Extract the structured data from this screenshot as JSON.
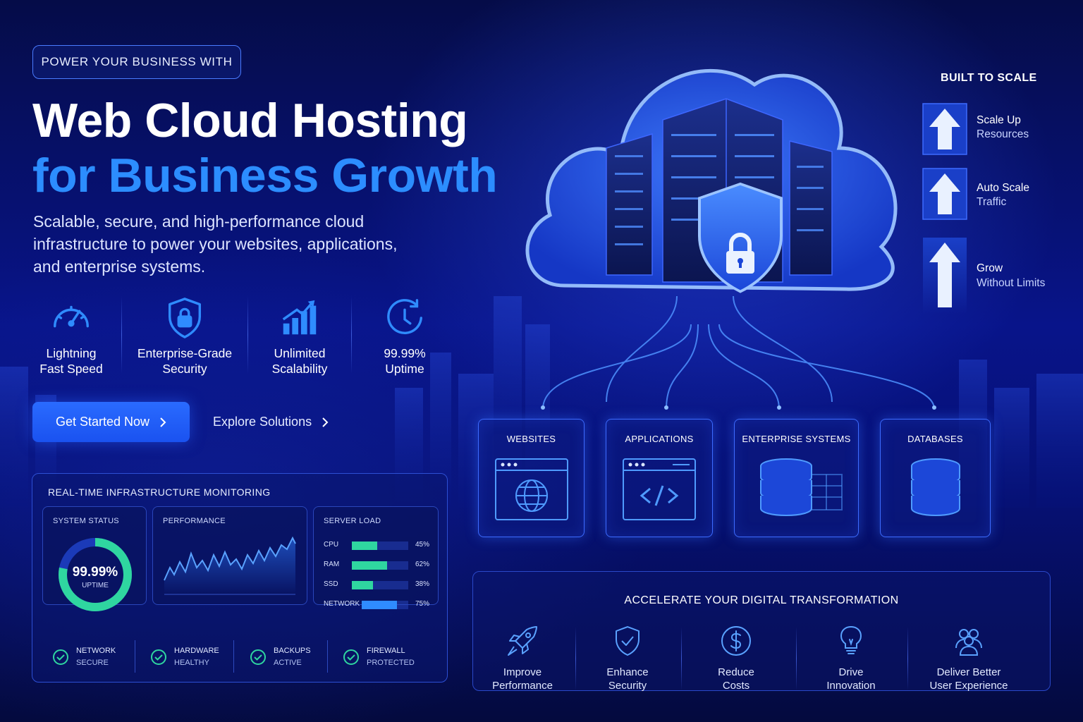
{
  "hero": {
    "tagline": "POWER YOUR BUSINESS WITH",
    "title_line1": "Web Cloud Hosting",
    "title_line2": "for Business Growth",
    "description": "Scalable, secure, and high-performance cloud infrastructure to power your websites, applications, and enterprise systems."
  },
  "features": [
    {
      "icon": "speedometer-icon",
      "line1": "Lightning",
      "line2": "Fast Speed"
    },
    {
      "icon": "shield-lock-icon",
      "line1": "Enterprise-Grade",
      "line2": "Security"
    },
    {
      "icon": "growth-chart-icon",
      "line1": "Unlimited",
      "line2": "Scalability"
    },
    {
      "icon": "clock-icon",
      "line1": "99.99%",
      "line2": "Uptime"
    }
  ],
  "actions": {
    "primary_label": "Get Started Now",
    "secondary_label": "Explore Solutions"
  },
  "monitoring": {
    "title": "REAL-TIME INFRASTRUCTURE MONITORING",
    "system_status": {
      "title": "SYSTEM STATUS",
      "value": "99.99%",
      "label": "UPTIME",
      "fill_fraction": 0.78
    },
    "performance": {
      "title": "PERFORMANCE"
    },
    "server_load": {
      "title": "SERVER LOAD",
      "rows": [
        {
          "name": "CPU",
          "percent": 45,
          "label": "45%"
        },
        {
          "name": "RAM",
          "percent": 62,
          "label": "62%"
        },
        {
          "name": "SSD",
          "percent": 38,
          "label": "38%"
        },
        {
          "name": "NETWORK",
          "percent": 75,
          "label": "75%"
        }
      ]
    },
    "statuses": [
      {
        "name": "NETWORK",
        "state": "SECURE"
      },
      {
        "name": "HARDWARE",
        "state": "HEALTHY"
      },
      {
        "name": "BACKUPS",
        "state": "ACTIVE"
      },
      {
        "name": "FIREWALL",
        "state": "PROTECTED"
      }
    ]
  },
  "scale": {
    "title": "BUILT TO SCALE",
    "items": [
      {
        "line1": "Scale Up",
        "line2": "Resources"
      },
      {
        "line1": "Auto Scale",
        "line2": "Traffic"
      },
      {
        "line1": "Grow",
        "line2": "Without Limits"
      }
    ]
  },
  "categories": [
    {
      "label": "WEBSITES",
      "icon": "globe-browser-icon"
    },
    {
      "label": "APPLICATIONS",
      "icon": "code-browser-icon"
    },
    {
      "label": "ENTERPRISE SYSTEMS",
      "icon": "server-stack-icon"
    },
    {
      "label": "DATABASES",
      "icon": "database-icon"
    }
  ],
  "benefits": {
    "title": "ACCELERATE YOUR DIGITAL TRANSFORMATION",
    "items": [
      {
        "icon": "rocket-icon",
        "line1": "Improve",
        "line2": "Performance"
      },
      {
        "icon": "shield-check-icon",
        "line1": "Enhance",
        "line2": "Security"
      },
      {
        "icon": "dollar-coin-icon",
        "line1": "Reduce",
        "line2": "Costs"
      },
      {
        "icon": "lightbulb-icon",
        "line1": "Drive",
        "line2": "Innovation"
      },
      {
        "icon": "users-icon",
        "line1": "Deliver Better",
        "line2": "User Experience"
      }
    ]
  },
  "colors": {
    "background": "#06117a",
    "accent_blue": "#2c8dff",
    "primary_button": "#1f5df5",
    "status_green": "#2fd6a0"
  }
}
